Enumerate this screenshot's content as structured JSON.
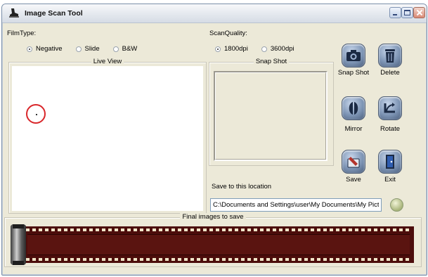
{
  "window": {
    "title": "Image Scan Tool"
  },
  "film_type": {
    "label": "FilmType:",
    "options": [
      {
        "label": "Negative",
        "checked": true
      },
      {
        "label": "Slide",
        "checked": false
      },
      {
        "label": "B&W",
        "checked": false
      }
    ]
  },
  "scan_quality": {
    "label": "ScanQuality:",
    "options": [
      {
        "label": "1800dpi",
        "checked": true
      },
      {
        "label": "3600dpi",
        "checked": false
      }
    ]
  },
  "live_view": {
    "label": "Live View"
  },
  "snap_shot": {
    "label": "Snap Shot"
  },
  "tools": {
    "snap_shot": "Snap Shot",
    "delete": "Delete",
    "mirror": "Mirror",
    "rotate": "Rotate",
    "save": "Save",
    "exit": "Exit"
  },
  "save_location": {
    "label": "Save to this location",
    "path": "C:\\Documents and Settings\\user\\My Documents\\My Pict"
  },
  "final_images": {
    "label": "Final images to save"
  },
  "colors": {
    "accent_red": "#d9262a",
    "film": "#4c0d0b",
    "window_bg": "#ece9d8"
  }
}
